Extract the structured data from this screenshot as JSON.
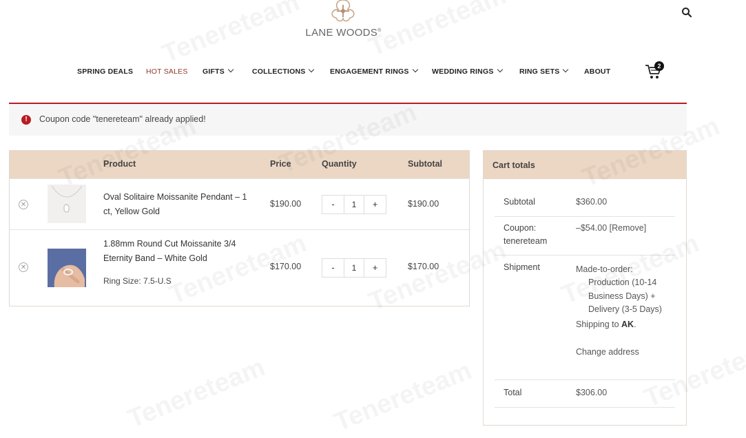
{
  "brand": {
    "name": "LANE WOODS",
    "reg": "®"
  },
  "nav": {
    "items": [
      {
        "label": "SPRING DEALS",
        "dropdown": false,
        "hot": false
      },
      {
        "label": "HOT SALES",
        "dropdown": false,
        "hot": true
      },
      {
        "label": "GIFTS",
        "dropdown": true,
        "hot": false
      },
      {
        "label": "COLLECTIONS",
        "dropdown": true,
        "hot": false
      },
      {
        "label": "ENGAGEMENT RINGS",
        "dropdown": true,
        "hot": false
      },
      {
        "label": "WEDDING RINGS",
        "dropdown": true,
        "hot": false
      },
      {
        "label": "RING SETS",
        "dropdown": true,
        "hot": false
      },
      {
        "label": "ABOUT",
        "dropdown": false,
        "hot": false
      }
    ],
    "cart_count": "2"
  },
  "notice": {
    "text": "Coupon code \"tenereteam\" already applied!"
  },
  "cart": {
    "headers": {
      "product": "Product",
      "price": "Price",
      "quantity": "Quantity",
      "subtotal": "Subtotal"
    },
    "rows": [
      {
        "name": "Oval Solitaire Moissanite Pendant – 1 ct, Yellow Gold",
        "meta": "",
        "price": "$190.00",
        "qty": "1",
        "subtotal": "$190.00"
      },
      {
        "name": "1.88mm Round Cut Moissanite 3/4 Eternity Band – White Gold",
        "meta": "Ring Size: 7.5-U.S",
        "price": "$170.00",
        "qty": "1",
        "subtotal": "$170.00"
      }
    ],
    "minus": "-",
    "plus": "+"
  },
  "totals": {
    "title": "Cart totals",
    "subtotal_label": "Subtotal",
    "subtotal_value": "$360.00",
    "coupon_label": "Coupon: tenereteam",
    "coupon_value": "–$54.00",
    "coupon_remove": "[Remove]",
    "shipment_label": "Shipment",
    "shipment_method": "Made-to-order:",
    "shipment_detail": "Production (10-14 Business Days) + Delivery (3-5 Days)",
    "shipping_to_prefix": "Shipping to ",
    "shipping_to_state": "AK",
    "change_address": "Change address",
    "total_label": "Total",
    "total_value": "$306.00"
  },
  "watermark": "Tenereteam",
  "colors": {
    "accent": "#b81c23",
    "header_bg": "#ecd7c4",
    "hot": "#8e3a2a"
  }
}
